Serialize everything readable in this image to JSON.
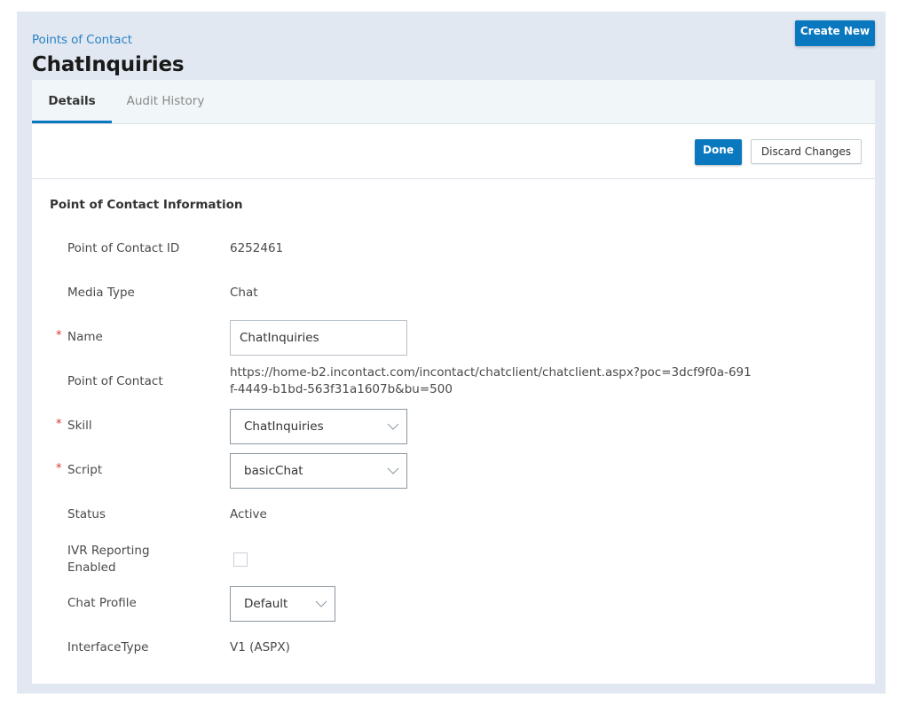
{
  "header": {
    "breadcrumb": "Points of Contact",
    "title": "ChatInquiries",
    "create_new_label": "Create New"
  },
  "tabs": [
    {
      "label": "Details",
      "active": true
    },
    {
      "label": "Audit History",
      "active": false
    }
  ],
  "actions": {
    "done_label": "Done",
    "discard_label": "Discard Changes"
  },
  "section": {
    "title": "Point of Contact Information"
  },
  "fields": {
    "poc_id": {
      "label": "Point of Contact ID",
      "value": "6252461"
    },
    "media_type": {
      "label": "Media Type",
      "value": "Chat"
    },
    "name": {
      "label": "Name",
      "required": true,
      "value": "ChatInquiries"
    },
    "point_of_contact": {
      "label": "Point of Contact",
      "value": "https://home-b2.incontact.com/incontact/chatclient/chatclient.aspx?poc=3dcf9f0a-691f-4449-b1bd-563f31a1607b&bu=500"
    },
    "skill": {
      "label": "Skill",
      "required": true,
      "value": "ChatInquiries"
    },
    "script": {
      "label": "Script",
      "required": true,
      "value": "basicChat"
    },
    "status": {
      "label": "Status",
      "value": "Active"
    },
    "ivr_reporting": {
      "label": "IVR Reporting Enabled",
      "checked": false
    },
    "chat_profile": {
      "label": "Chat Profile",
      "value": "Default"
    },
    "interface_type": {
      "label": "InterfaceType",
      "value": "V1 (ASPX)"
    }
  },
  "required_marker": "*",
  "colors": {
    "accent": "#0a78be",
    "breadcrumb": "#2b82c4",
    "required": "#d9342b",
    "page_bg": "#e1e8f1",
    "tabbar_bg": "#f1f6f9"
  }
}
